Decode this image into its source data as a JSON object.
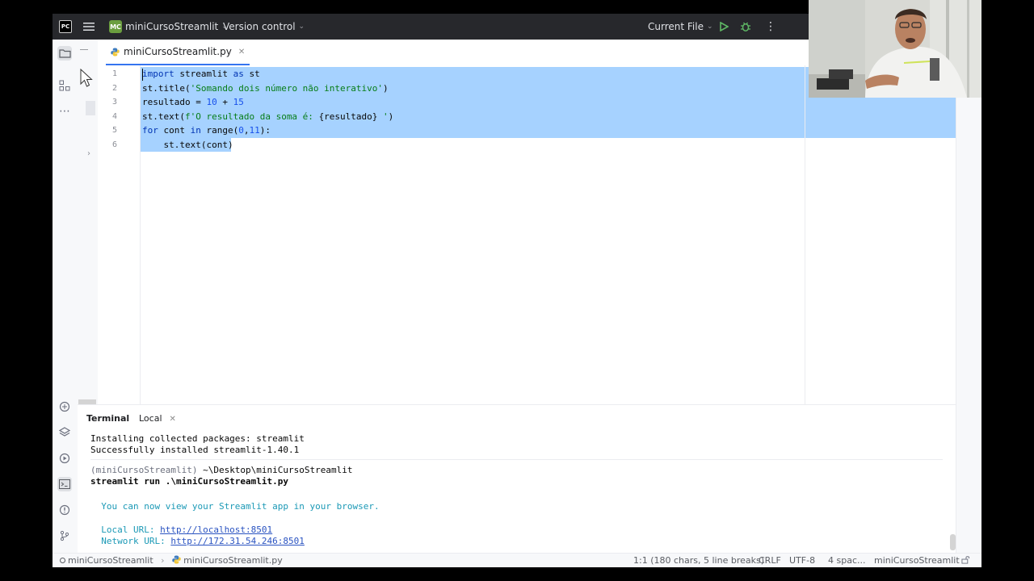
{
  "titlebar": {
    "logo": "PC",
    "project_badge": "MC",
    "project_name": "miniCursoStreamlit",
    "vcs_label": "Version control",
    "run_config": "Current File"
  },
  "editor": {
    "tab_label": "miniCursoStreamlit.py",
    "line_numbers": [
      "1",
      "2",
      "3",
      "4",
      "5",
      "6"
    ],
    "lines": [
      [
        {
          "t": "import",
          "c": "kw"
        },
        {
          "t": " streamlit ",
          "c": ""
        },
        {
          "t": "as",
          "c": "kw"
        },
        {
          "t": " st",
          "c": ""
        }
      ],
      [
        {
          "t": "st.title(",
          "c": ""
        },
        {
          "t": "'Somando dois número não interativo'",
          "c": "str"
        },
        {
          "t": ")",
          "c": ""
        }
      ],
      [
        {
          "t": "resultado = ",
          "c": ""
        },
        {
          "t": "10",
          "c": "num"
        },
        {
          "t": " + ",
          "c": ""
        },
        {
          "t": "15",
          "c": "num"
        }
      ],
      [
        {
          "t": "st.text(",
          "c": ""
        },
        {
          "t": "f'O resultado da soma é: ",
          "c": "str"
        },
        {
          "t": "{resultado}",
          "c": ""
        },
        {
          "t": " '",
          "c": "str"
        },
        {
          "t": ")",
          "c": ""
        }
      ],
      [
        {
          "t": "for",
          "c": "kw"
        },
        {
          "t": " cont ",
          "c": ""
        },
        {
          "t": "in",
          "c": "kw"
        },
        {
          "t": " range(",
          "c": ""
        },
        {
          "t": "0",
          "c": "num"
        },
        {
          "t": ",",
          "c": ""
        },
        {
          "t": "11",
          "c": "num"
        },
        {
          "t": "):",
          "c": ""
        }
      ],
      [
        {
          "t": "    st.text(cont)",
          "c": ""
        }
      ]
    ]
  },
  "terminal": {
    "title": "Terminal",
    "tab_label": "Local",
    "line1": "Installing collected packages: streamlit",
    "line2": "Successfully installed streamlit-1.40.1",
    "prompt_env": "(miniCursoStreamlit)",
    "prompt_path": " ~\\Desktop\\miniCursoStreamlit",
    "command": "streamlit run .\\miniCursoStreamlit.py",
    "info": "  You can now view your Streamlit app in your browser.",
    "local_label": "  Local URL: ",
    "local_url": "http://localhost:8501",
    "network_label": "  Network URL: ",
    "network_url": "http://172.31.54.246:8501"
  },
  "statusbar": {
    "project": "miniCursoStreamlit",
    "file": "miniCursoStreamlit.py",
    "position": "1:1 (180 chars, 5 line breaks)",
    "line_sep": "CRLF",
    "encoding": "UTF-8",
    "indent": "4 spac...",
    "interpreter": "miniCursoStreamlit"
  },
  "colors": {
    "selection": "#a6d2ff",
    "titlebar": "#27282c",
    "keyword": "#0033b3",
    "string": "#067d17",
    "number": "#1750eb"
  }
}
